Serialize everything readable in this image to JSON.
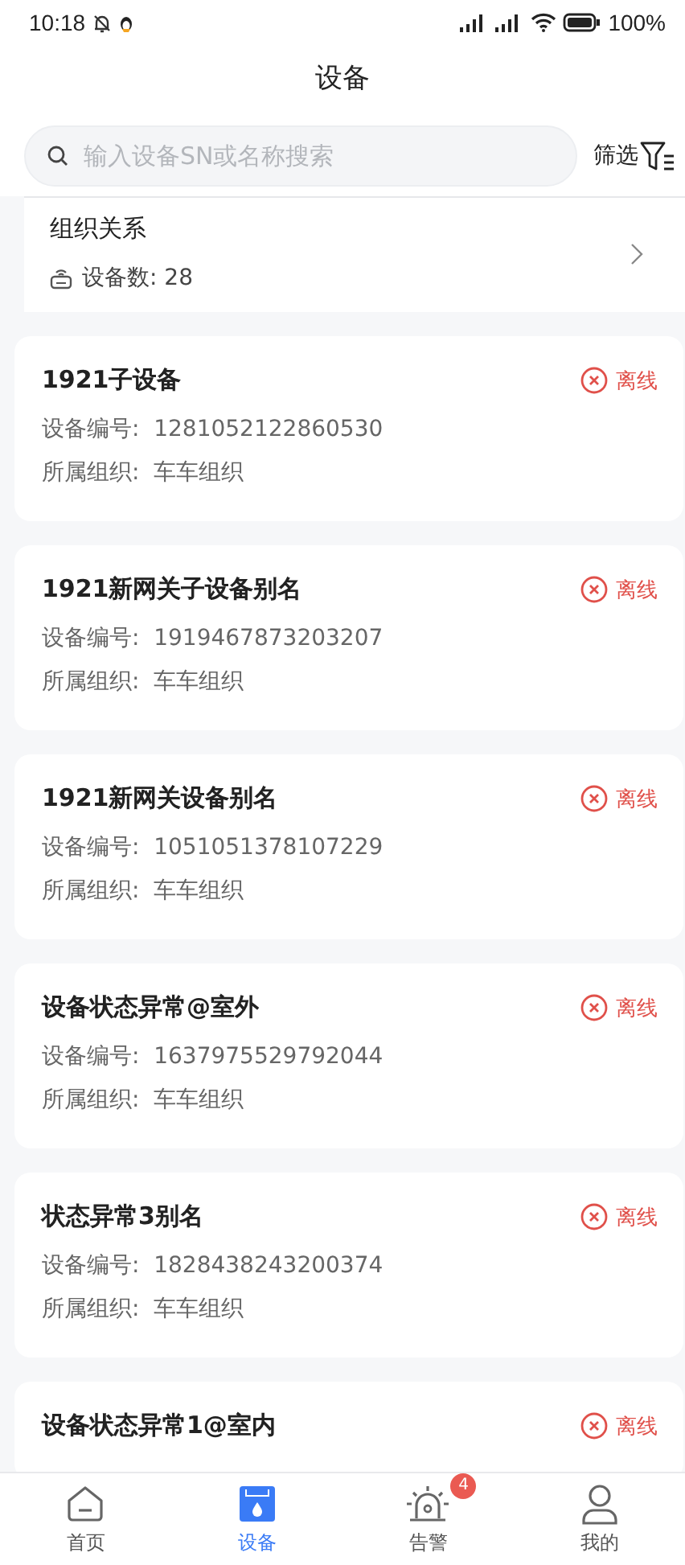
{
  "status_bar": {
    "time": "10:18",
    "battery": "100%"
  },
  "title": "设备",
  "search": {
    "placeholder": "输入设备SN或名称搜索"
  },
  "filter": {
    "label": "筛选"
  },
  "org": {
    "title": "组织关系",
    "count_label": "设备数:",
    "count": "28"
  },
  "devices": [
    {
      "name": "1921子设备",
      "status": {
        "kind": "offline",
        "label": "离线"
      },
      "fields": [
        {
          "label": "设备编号:",
          "value": "1281052122860530"
        },
        {
          "label": "所属组织:",
          "value": "车车组织"
        }
      ]
    },
    {
      "name": "1921新网关子设备别名",
      "status": {
        "kind": "offline",
        "label": "离线"
      },
      "fields": [
        {
          "label": "设备编号:",
          "value": "1919467873203207"
        },
        {
          "label": "所属组织:",
          "value": "车车组织"
        }
      ]
    },
    {
      "name": "1921新网关设备别名",
      "status": {
        "kind": "offline",
        "label": "离线"
      },
      "fields": [
        {
          "label": "设备编号:",
          "value": "1051051378107229"
        },
        {
          "label": "所属组织:",
          "value": "车车组织"
        }
      ]
    },
    {
      "name": "设备状态异常@室外",
      "status": {
        "kind": "offline",
        "label": "离线"
      },
      "fields": [
        {
          "label": "设备编号:",
          "value": "1637975529792044"
        },
        {
          "label": "所属组织:",
          "value": "车车组织"
        }
      ]
    },
    {
      "name": "状态异常3别名",
      "status": {
        "kind": "offline",
        "label": "离线"
      },
      "fields": [
        {
          "label": "设备编号:",
          "value": "1828438243200374"
        },
        {
          "label": "所属组织:",
          "value": "车车组织"
        }
      ]
    },
    {
      "name": "设备状态异常1@室内",
      "status": {
        "kind": "offline",
        "label": "离线"
      }
    }
  ],
  "tabs": [
    {
      "kind": "home",
      "label": "首页",
      "selected": false
    },
    {
      "kind": "device",
      "label": "设备",
      "selected": true
    },
    {
      "kind": "alarm",
      "label": "告警",
      "selected": false,
      "badge": "4"
    },
    {
      "kind": "me",
      "label": "我的",
      "selected": false
    }
  ]
}
